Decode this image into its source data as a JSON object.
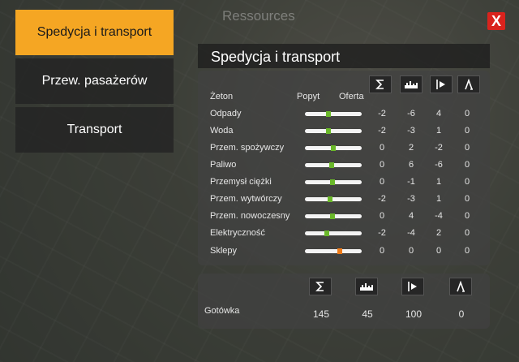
{
  "window": {
    "title": "Ressources",
    "close_label": "X"
  },
  "tabs": [
    {
      "label": "Spedycja i transport",
      "active": true
    },
    {
      "label": "Przew. pasażerów",
      "active": false
    },
    {
      "label": "Transport",
      "active": false
    }
  ],
  "section": {
    "title": "Spedycja i transport"
  },
  "table": {
    "headers": {
      "token": "Żeton",
      "demand": "Popyt",
      "supply": "Oferta"
    },
    "column_icons": [
      "sigma-icon",
      "skyline-icon",
      "arrow-right-icon",
      "lambda-icon"
    ],
    "rows": [
      {
        "name": "Odpady",
        "slider": 0.42,
        "values": [
          "-2",
          "-6",
          "4",
          "0"
        ]
      },
      {
        "name": "Woda",
        "slider": 0.42,
        "values": [
          "-2",
          "-3",
          "1",
          "0"
        ]
      },
      {
        "name": "Przem. spożywczy",
        "slider": 0.5,
        "values": [
          "0",
          "2",
          "-2",
          "0"
        ]
      },
      {
        "name": "Paliwo",
        "slider": 0.47,
        "values": [
          "0",
          "6",
          "-6",
          "0"
        ]
      },
      {
        "name": "Przemysł ciężki",
        "slider": 0.48,
        "values": [
          "0",
          "-1",
          "1",
          "0"
        ]
      },
      {
        "name": "Przem. wytwórczy",
        "slider": 0.44,
        "values": [
          "-2",
          "-3",
          "1",
          "0"
        ]
      },
      {
        "name": "Przem. nowoczesny",
        "slider": 0.49,
        "values": [
          "0",
          "4",
          "-4",
          "0"
        ]
      },
      {
        "name": "Elektryczność",
        "slider": 0.38,
        "values": [
          "-2",
          "-4",
          "2",
          "0"
        ]
      },
      {
        "name": "Sklepy",
        "slider": 0.62,
        "values": [
          "0",
          "0",
          "0",
          "0"
        ],
        "warning": true
      }
    ]
  },
  "cash": {
    "label": "Gotówka",
    "values": [
      "145",
      "45",
      "100",
      "0"
    ]
  },
  "colors": {
    "accent": "#f5a623",
    "close": "#d9231d",
    "good": "#6ab82a",
    "warn": "#ee7a18"
  }
}
